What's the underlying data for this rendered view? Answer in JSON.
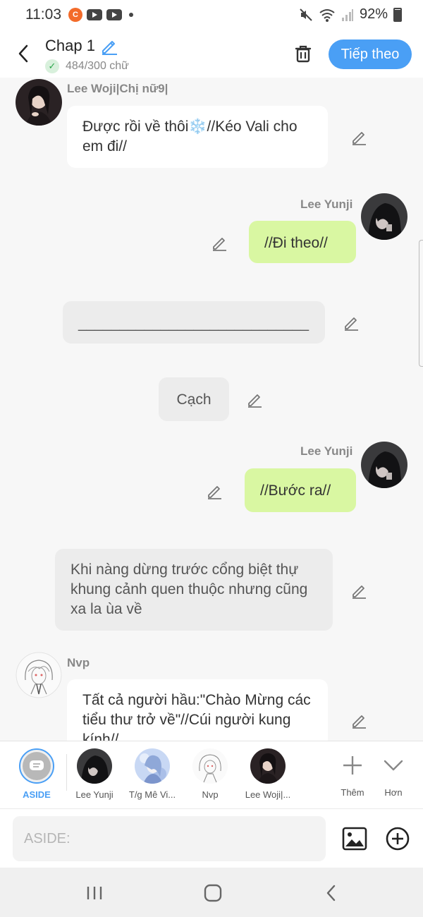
{
  "status_bar": {
    "time": "11:03",
    "battery": "92%",
    "app_icon_letter": "C"
  },
  "header": {
    "title": "Chap 1",
    "word_count": "484/300 chữ",
    "next_label": "Tiếp theo"
  },
  "messages": [
    {
      "type": "incoming",
      "name": "Lee Woji|Chị nữ9|",
      "text": "Được rồi về thôi❄️//Kéo Vali cho em đi//"
    },
    {
      "type": "outgoing",
      "name": "Lee Yunji",
      "text": "//Đi theo//"
    },
    {
      "type": "aside",
      "text": "____________________________"
    },
    {
      "type": "aside",
      "text": "Cạch"
    },
    {
      "type": "outgoing",
      "name": "Lee Yunji",
      "text": "//Bước ra//"
    },
    {
      "type": "aside",
      "text": "Khi nàng dừng trước cổng biệt thự khung cảnh quen thuộc nhưng cũng xa la ùa về"
    },
    {
      "type": "incoming",
      "name": "Nvp",
      "text": "Tất cả người hầu:\"Chào Mừng các tiểu thư trở về\"//Cúi người kung kính//"
    }
  ],
  "characters": [
    {
      "label": "ASIDE",
      "selected": true
    },
    {
      "label": "Lee Yunji"
    },
    {
      "label": "T/g Mê Vi..."
    },
    {
      "label": "Nvp"
    },
    {
      "label": "Lee Woji|..."
    }
  ],
  "tools": {
    "add_label": "Thêm",
    "more_label": "Hơn"
  },
  "composer": {
    "placeholder": "ASIDE:"
  },
  "colors": {
    "accent": "#4a9ff5",
    "outgoing_bubble": "#d9f7a2",
    "incoming_bubble": "#ffffff",
    "aside_bubble": "#ececec"
  }
}
